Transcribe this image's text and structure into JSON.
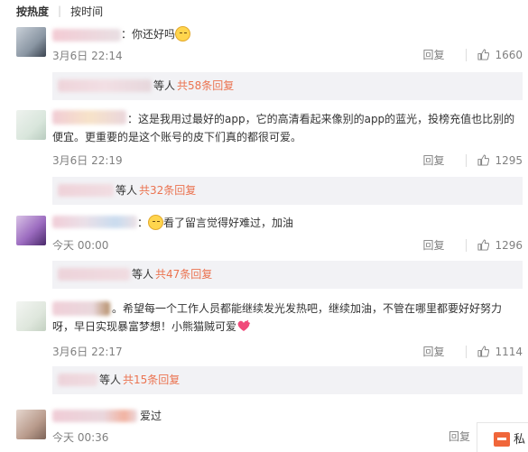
{
  "sort_tabs": {
    "hot": "按热度",
    "time": "按时间"
  },
  "comments": [
    {
      "text": "：你还好吗",
      "time": "3月6日 22:14",
      "reply_label": "回复",
      "likes": "1660",
      "replies": {
        "suffix": "等人",
        "more": "共58条回复"
      }
    },
    {
      "text": "：这是我用过最好的app，它的高清看起来像别的app的蓝光，投榜充值也比别的便宜。更重要的是这个账号的皮下们真的都很可爱。",
      "time": "3月6日 22:19",
      "reply_label": "回复",
      "likes": "1295",
      "replies": {
        "suffix": "等人",
        "more": "共32条回复"
      }
    },
    {
      "text": "看了留言觉得好难过，加油",
      "time": "今天 00:00",
      "reply_label": "回复",
      "likes": "1296",
      "replies": {
        "suffix": "等人",
        "more": "共47条回复"
      }
    },
    {
      "text": "。希望每一个工作人员都能继续发光发热吧，继续加油，不管在哪里都要好好努力呀，早日实现暴富梦想！小熊猫贼可爱",
      "time": "3月6日 22:17",
      "reply_label": "回复",
      "likes": "1114",
      "replies": {
        "suffix": "等人",
        "more": "共15条回复"
      }
    },
    {
      "text": "爱过",
      "time": "今天 00:36",
      "reply_label": "回复"
    }
  ],
  "float_button": {
    "label": "私"
  },
  "colors": {
    "accent": "#eb7350",
    "muted": "#808080",
    "reply_bg": "#f2f2f5"
  }
}
